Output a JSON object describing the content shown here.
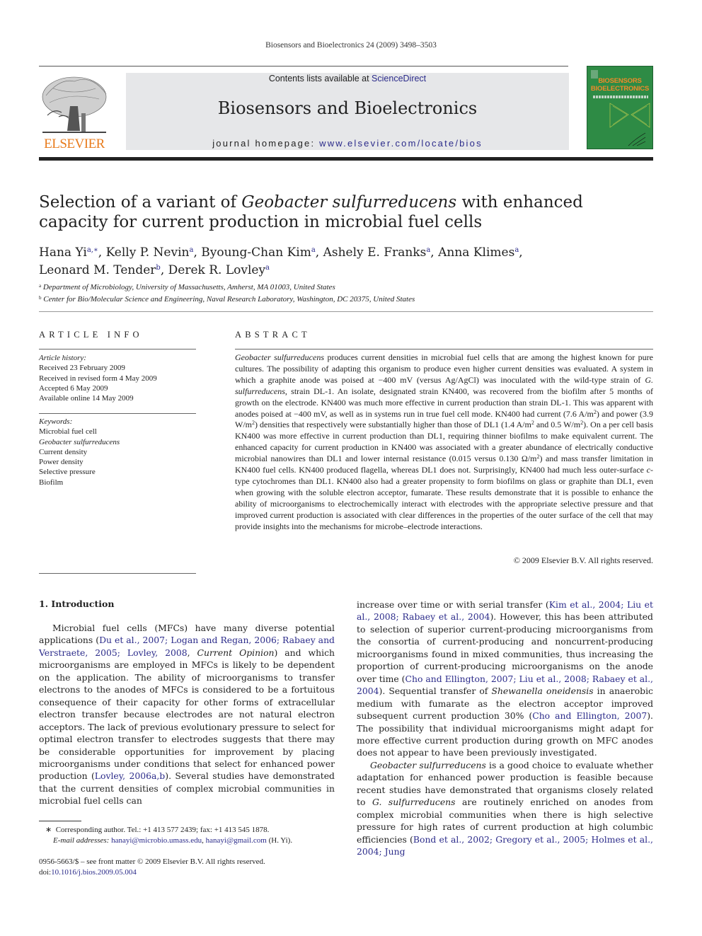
{
  "running_head": "Biosensors and Bioelectronics 24 (2009) 3498–3503",
  "publisher": {
    "logo_wordmark": "ELSEVIER",
    "logo_icon": "tree-icon",
    "brand_color": "#e87b1c"
  },
  "masthead": {
    "contents_prefix": "Contents lists available at ",
    "contents_link": "ScienceDirect",
    "journal_title": "Biosensors and Bioelectronics",
    "homepage_prefix": "journal homepage: ",
    "homepage_link": "www.elsevier.com/locate/bios",
    "background_color": "#e6e7e9",
    "link_color": "#2b2b8a"
  },
  "cover": {
    "title_line1": "BIOSENSORS",
    "title_line2": "BIOELECTRONICS",
    "background_color": "#2e8b45",
    "title_color": "#f08a2a"
  },
  "article": {
    "title_part1": "Selection of a variant of ",
    "title_italic": "Geobacter sulfurreducens",
    "title_part2": " with enhanced capacity for current production in microbial fuel cells",
    "authors": [
      {
        "name": "Hana Yi",
        "sup": "a,∗",
        "sep": ", "
      },
      {
        "name": "Kelly P. Nevin",
        "sup": "a",
        "sep": ", "
      },
      {
        "name": "Byoung-Chan Kim",
        "sup": "a",
        "sep": ", "
      },
      {
        "name": "Ashely E. Franks",
        "sup": "a",
        "sep": ", "
      },
      {
        "name": "Anna Klimes",
        "sup": "a",
        "sep": ","
      },
      {
        "name": "Leonard M. Tender",
        "sup": "b",
        "sep": ", "
      },
      {
        "name": "Derek R. Lovley",
        "sup": "a",
        "sep": ""
      }
    ],
    "affiliations": [
      {
        "sup": "a",
        "text": "Department of Microbiology, University of Massachusetts, Amherst, MA 01003, United States"
      },
      {
        "sup": "b",
        "text": "Center for Bio/Molecular Science and Engineering, Naval Research Laboratory, Washington, DC 20375, United States"
      }
    ]
  },
  "article_info": {
    "heading": "ARTICLE INFO",
    "history_label": "Article history:",
    "history": [
      "Received 23 February 2009",
      "Received in revised form 4 May 2009",
      "Accepted 6 May 2009",
      "Available online 14 May 2009"
    ],
    "keywords_label": "Keywords:",
    "keywords": [
      {
        "text": "Microbial fuel cell",
        "italic": false
      },
      {
        "text": "Geobacter sulfurreducens",
        "italic": true
      },
      {
        "text": "Current density",
        "italic": false
      },
      {
        "text": "Power density",
        "italic": false
      },
      {
        "text": "Selective pressure",
        "italic": false
      },
      {
        "text": "Biofilm",
        "italic": false
      }
    ]
  },
  "abstract": {
    "heading": "ABSTRACT",
    "segments": [
      {
        "t": "Geobacter sulfurreducens",
        "i": true
      },
      {
        "t": " produces current densities in microbial fuel cells that are among the highest known for pure cultures. The possibility of adapting this organism to produce even higher current densities was evaluated. A system in which a graphite anode was poised at −400 mV (versus Ag/AgCl) was inoculated with the wild-type strain of "
      },
      {
        "t": "G. sulfurreducens",
        "i": true
      },
      {
        "t": ", strain DL-1. An isolate, designated strain KN400, was recovered from the biofilm after 5 months of growth on the electrode. KN400 was much more effective in current production than strain DL-1. This was apparent with anodes poised at −400 mV, as well as in systems run in true fuel cell mode. KN400 had current (7.6 A/m"
      },
      {
        "t": "2",
        "sup": true
      },
      {
        "t": ") and power (3.9 W/m"
      },
      {
        "t": "2",
        "sup": true
      },
      {
        "t": ") densities that respectively were substantially higher than those of DL1 (1.4 A/m"
      },
      {
        "t": "2",
        "sup": true
      },
      {
        "t": " and 0.5 W/m"
      },
      {
        "t": "2",
        "sup": true
      },
      {
        "t": "). On a per cell basis KN400 was more effective in current production than DL1, requiring thinner biofilms to make equivalent current. The enhanced capacity for current production in KN400 was associated with a greater abundance of electrically conductive microbial nanowires than DL1 and lower internal resistance (0.015 versus 0.130 Ω/m"
      },
      {
        "t": "2",
        "sup": true
      },
      {
        "t": ") and mass transfer limitation in KN400 fuel cells. KN400 produced flagella, whereas DL1 does not. Surprisingly, KN400 had much less outer-surface "
      },
      {
        "t": "c",
        "i": true
      },
      {
        "t": "-type cytochromes than DL1. KN400 also had a greater propensity to form biofilms on glass or graphite than DL1, even when growing with the soluble electron acceptor, fumarate. These results demonstrate that it is possible to enhance the ability of microorganisms to electrochemically interact with electrodes with the appropriate selective pressure and that improved current production is associated with clear differences in the properties of the outer surface of the cell that may provide insights into the mechanisms for microbe–electrode interactions."
      }
    ],
    "copyright": "© 2009 Elsevier B.V. All rights reserved."
  },
  "introduction": {
    "heading": "1.  Introduction",
    "left_column": [
      {
        "t": "Microbial fuel cells (MFCs) have many diverse potential applications ("
      },
      {
        "t": "Du et al., 2007; Logan and Regan, 2006; Rabaey and Verstraete, 2005; Lovley, 2008",
        "link": true
      },
      {
        "t": ", "
      },
      {
        "t": "Current Opinion",
        "i": true
      },
      {
        "t": ") and which microorganisms are employed in MFCs is likely to be dependent on the application. The ability of microorganisms to transfer electrons to the anodes of MFCs is considered to be a fortuitous consequence of their capacity for other forms of extracellular electron transfer because electrodes are not natural electron acceptors. The lack of previous evolutionary pressure to select for optimal electron transfer to electrodes suggests that there may be considerable opportunities for improvement by placing microorganisms under conditions that select for enhanced power production ("
      },
      {
        "t": "Lovley, 2006a,b",
        "link": true
      },
      {
        "t": "). Several studies have demonstrated that the current densities of complex microbial communities in microbial fuel cells can"
      }
    ],
    "right_column_p1": [
      {
        "t": "increase over time or with serial transfer ("
      },
      {
        "t": "Kim et al., 2004; Liu et al., 2008; Rabaey et al., 2004",
        "link": true
      },
      {
        "t": "). However, this has been attributed to selection of superior current-producing microorganisms from the consortia of current-producing and noncurrent-producing microorganisms found in mixed communities, thus increasing the proportion of current-producing microorganisms on the anode over time ("
      },
      {
        "t": "Cho and Ellington, 2007; Liu et al., 2008; Rabaey et al., 2004",
        "link": true
      },
      {
        "t": "). Sequential transfer of "
      },
      {
        "t": "Shewanella oneidensis",
        "i": true
      },
      {
        "t": " in anaerobic medium with fumarate as the electron acceptor improved subsequent current production 30% ("
      },
      {
        "t": "Cho and Ellington, 2007",
        "link": true
      },
      {
        "t": "). The possibility that individual microorganisms might adapt for more effective current production during growth on MFC anodes does not appear to have been previously investigated."
      }
    ],
    "right_column_p2": [
      {
        "t": "Geobacter sulfurreducens",
        "i": true
      },
      {
        "t": " is a good choice to evaluate whether adaptation for enhanced power production is feasible because recent studies have demonstrated that organisms closely related to "
      },
      {
        "t": "G. sulfurreducens",
        "i": true
      },
      {
        "t": " are routinely enriched on anodes from complex microbial communities when there is high selective pressure for high rates of current production at high columbic efficiencies ("
      },
      {
        "t": "Bond et al., 2002; Gregory et al., 2005; Holmes et al., 2004; Jung",
        "link": true
      }
    ]
  },
  "footnote": {
    "marker": "∗",
    "corresponding": "Corresponding author. Tel.: +1 413 577 2439; fax: +1 413 545 1878.",
    "email_label": "E-mail addresses:",
    "emails": [
      "hanayi@microbio.umass.edu",
      "hanayi@gmail.com"
    ],
    "email_suffix": " (H. Yi)."
  },
  "front_matter": {
    "issn_line": "0956-5663/$ – see front matter © 2009 Elsevier B.V. All rights reserved.",
    "doi_label": "doi:",
    "doi": "10.1016/j.bios.2009.05.004"
  }
}
